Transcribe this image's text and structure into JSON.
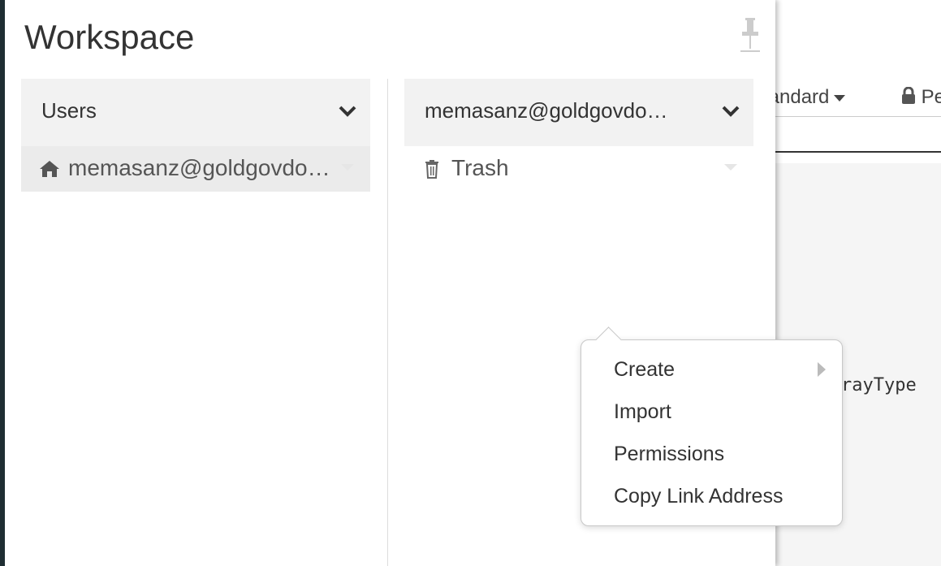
{
  "background": {
    "toolbar_lang": "tandard",
    "toolbar_perm": "Pe",
    "code_snippet": "rayType"
  },
  "workspace": {
    "title": "Workspace",
    "left_column": {
      "header": "Users",
      "items": [
        {
          "label": "memasanz@goldgovdom…",
          "icon": "home-icon",
          "selected": true
        }
      ]
    },
    "right_column": {
      "header": "memasanz@goldgovdo…",
      "items": [
        {
          "label": "Trash",
          "icon": "trash-icon",
          "selected": false
        }
      ]
    }
  },
  "context_menu": {
    "items": [
      {
        "label": "Create",
        "has_submenu": true
      },
      {
        "label": "Import",
        "has_submenu": false
      },
      {
        "label": "Permissions",
        "has_submenu": false
      },
      {
        "label": "Copy Link Address",
        "has_submenu": false
      }
    ]
  },
  "colors": {
    "sidebar_edge": "#1f2e33",
    "header_bg": "#f2f2f2",
    "selected_bg": "#ebebeb"
  }
}
